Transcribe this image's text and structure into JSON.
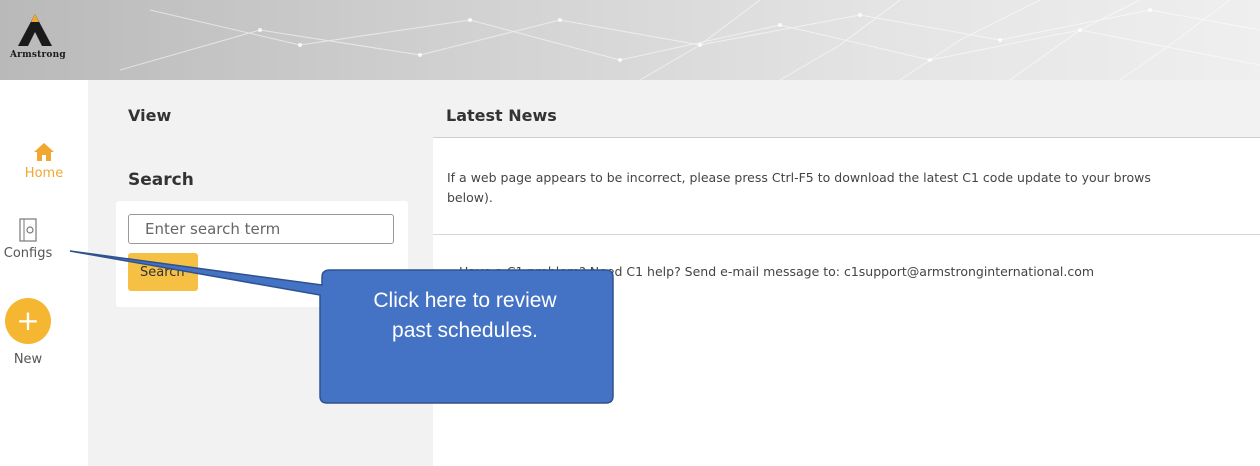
{
  "brand": {
    "logo_text": "Armstrong"
  },
  "nav": {
    "home_label": "Home",
    "configs_label": "Configs",
    "new_label": "New",
    "new_symbol": "+"
  },
  "view": {
    "title": "View",
    "search_title": "Search",
    "search_placeholder": "Enter search term",
    "search_button": "Search"
  },
  "news": {
    "title": "Latest News",
    "item1_line1": "If a web page appears to be incorrect, please press Ctrl-F5 to download the latest C1 code update to your brows",
    "item1_line2": "below).",
    "item2": "Need C1 help? Send e-mail message to: c1support@armstronginternational.com"
  },
  "callout": {
    "line1": "Click here to review",
    "line2": "past schedules."
  },
  "colors": {
    "accent": "#f5b731",
    "callout_fill": "#4472c4",
    "callout_border": "#2f528f"
  }
}
